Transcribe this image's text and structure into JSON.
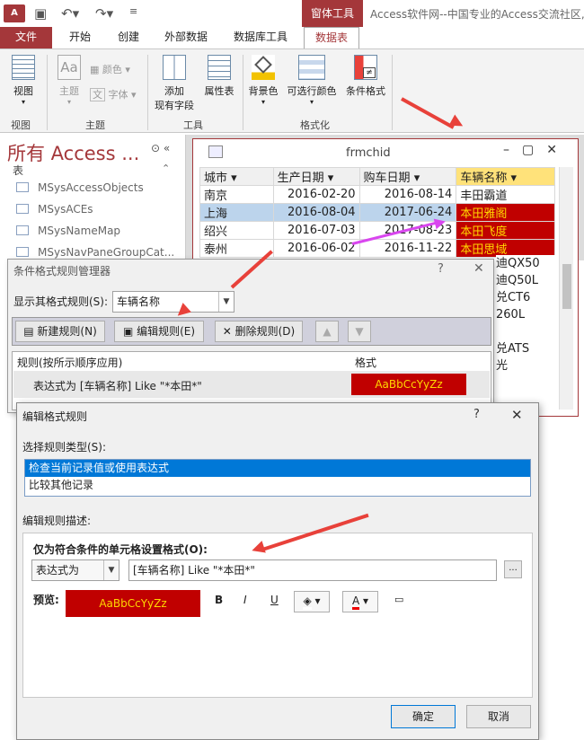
{
  "app": {
    "icon_text": "A",
    "title": "Access软件网--中国专业的Access交流社区,基",
    "context_tab": "窗体工具"
  },
  "tabs": [
    {
      "label": "文件"
    },
    {
      "label": "开始"
    },
    {
      "label": "创建"
    },
    {
      "label": "外部数据"
    },
    {
      "label": "数据库工具"
    },
    {
      "label": "数据表"
    }
  ],
  "ribbon": {
    "view": "视图",
    "view_group": "视图",
    "theme": "主题",
    "colors": "颜色",
    "fonts": "字体",
    "theme_group": "主题",
    "add_field_1": "添加",
    "add_field_2": "现有字段",
    "property": "属性表",
    "tools_group": "工具",
    "bg_color": "背景色",
    "alt_color": "可选行颜色",
    "cond_format": "条件格式",
    "format_group": "格式化"
  },
  "nav": {
    "title": "所有 Access ...",
    "section": "表",
    "items": [
      "MSysAccessObjects",
      "MSysACEs",
      "MSysNameMap",
      "MSysNavPaneGroupCat..."
    ]
  },
  "form": {
    "title": "frmchid",
    "headers": [
      "城市",
      "生产日期",
      "购车日期",
      "车辆名称"
    ],
    "rows": [
      [
        "南京",
        "2016-02-20",
        "2016-08-14",
        "丰田霸道"
      ],
      [
        "上海",
        "2016-08-04",
        "2017-06-24",
        "本田雅阁"
      ],
      [
        "绍兴",
        "2016-07-03",
        "2017-08-23",
        "本田飞度"
      ],
      [
        "泰州",
        "2016-06-02",
        "2016-11-22",
        "本田思域"
      ]
    ],
    "partial": [
      "迪QX50",
      "迪Q50L",
      "兑CT6",
      "260L",
      "",
      "兑ATS",
      "光"
    ]
  },
  "dialog1": {
    "title": "条件格式规则管理器",
    "show_label": "显示其格式规则(S):",
    "show_value": "车辆名称",
    "new_rule": "新建规则(N)",
    "edit_rule": "编辑规则(E)",
    "delete_rule": "删除规则(D)",
    "col_rule": "规则(按所示顺序应用)",
    "col_format": "格式",
    "rule_text": "表达式为 [车辆名称] Like \"*本田*\"",
    "preview": "AaBbCcYyZz"
  },
  "dialog2": {
    "title": "编辑格式规则",
    "select_type": "选择规则类型(S):",
    "types": [
      "检查当前记录值或使用表达式",
      "比较其他记录"
    ],
    "desc_label": "编辑规则描述:",
    "only_label": "仅为符合条件的单元格设置格式(O):",
    "cond_type": "表达式为",
    "expr": "[车辆名称] Like \"*本田*\"",
    "preview_label": "预览:",
    "preview": "AaBbCcYyZz",
    "ok": "确定",
    "cancel": "取消",
    "more": "..."
  },
  "colors": {
    "accent": "#a4373a",
    "highlight": "#c00000",
    "highlight_text": "#ffd700",
    "arrow": "#e8413a",
    "magenta": "#d946ef"
  }
}
